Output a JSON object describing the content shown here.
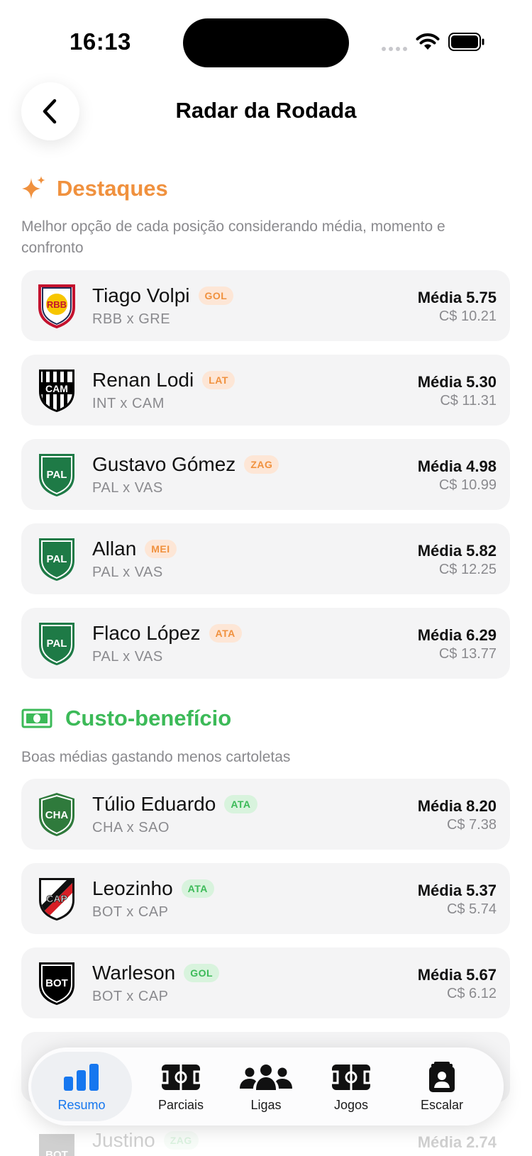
{
  "status_bar": {
    "time": "16:13"
  },
  "header": {
    "title": "Radar da Rodada"
  },
  "colors": {
    "accent_orange": "#f0913e",
    "accent_green": "#3cba58",
    "tab_active_blue": "#1677ef"
  },
  "destaques": {
    "title": "Destaques",
    "icon": "sparkle-icon",
    "description": "Melhor opção de cada posição considerando média, momento e confronto",
    "players": [
      {
        "name": "Tiago Volpi",
        "pos": "GOL",
        "match": "RBB x GRE",
        "media": "Média 5.75",
        "price": "C$ 10.21",
        "crest": "RBB"
      },
      {
        "name": "Renan Lodi",
        "pos": "LAT",
        "match": "INT x CAM",
        "media": "Média 5.30",
        "price": "C$ 11.31",
        "crest": "CAM"
      },
      {
        "name": "Gustavo Gómez",
        "pos": "ZAG",
        "match": "PAL x VAS",
        "media": "Média 4.98",
        "price": "C$ 10.99",
        "crest": "PAL"
      },
      {
        "name": "Allan",
        "pos": "MEI",
        "match": "PAL x VAS",
        "media": "Média 5.82",
        "price": "C$ 12.25",
        "crest": "PAL"
      },
      {
        "name": "Flaco López",
        "pos": "ATA",
        "match": "PAL x VAS",
        "media": "Média 6.29",
        "price": "C$ 13.77",
        "crest": "PAL"
      }
    ]
  },
  "custo": {
    "title": "Custo-benefício",
    "icon": "money-bill-icon",
    "description": "Boas médias gastando menos cartoletas",
    "players": [
      {
        "name": "Túlio Eduardo",
        "pos": "ATA",
        "match": "CHA x SAO",
        "media": "Média 8.20",
        "price": "C$ 7.38",
        "crest": "CHA"
      },
      {
        "name": "Leozinho",
        "pos": "ATA",
        "match": "BOT x CAP",
        "media": "Média 5.37",
        "price": "C$ 5.74",
        "crest": "CAP"
      },
      {
        "name": "Warleson",
        "pos": "GOL",
        "match": "BOT x CAP",
        "media": "Média 5.67",
        "price": "C$ 6.12",
        "crest": "BOT"
      }
    ],
    "partial_bottom": {
      "name": "Justino",
      "pos": "ZAG",
      "media": "Média 2.74",
      "crest": "BOT"
    }
  },
  "tabs": [
    {
      "label": "Resumo",
      "icon": "bar-chart-icon",
      "active": true
    },
    {
      "label": "Parciais",
      "icon": "field-icon",
      "active": false
    },
    {
      "label": "Ligas",
      "icon": "people-icon",
      "active": false
    },
    {
      "label": "Jogos",
      "icon": "field-icon",
      "active": false
    },
    {
      "label": "Escalar",
      "icon": "player-card-icon",
      "active": false
    }
  ]
}
